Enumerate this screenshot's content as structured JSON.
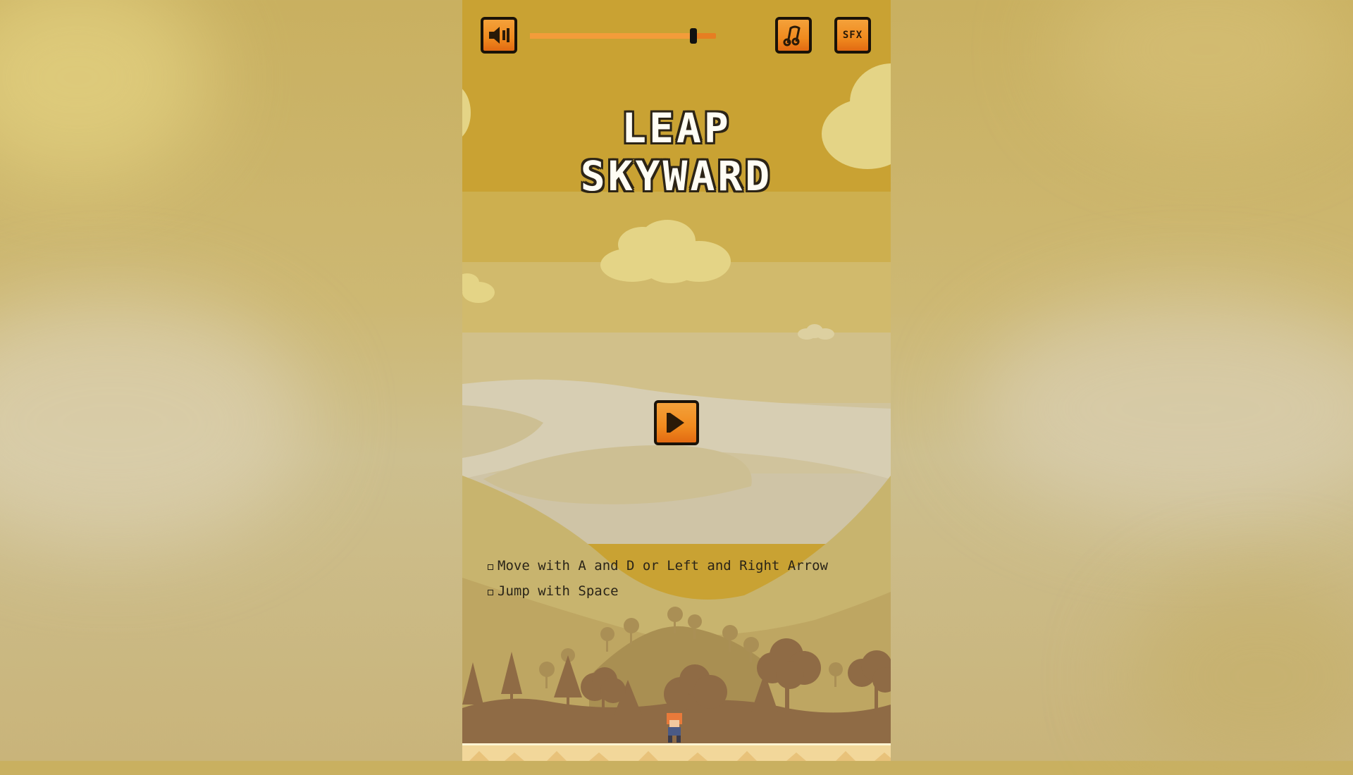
{
  "game": {
    "title_line1": "LEAP",
    "title_line2": "SKYWARD",
    "instructions": [
      "Move with A and D or Left and Right Arrow",
      "Jump with Space"
    ]
  },
  "controls": {
    "volume_level": 0.88,
    "buttons": {
      "sound": "speaker-icon",
      "music": "music-note-icon",
      "sfx": "SFX",
      "play": "play-icon"
    }
  },
  "colors": {
    "button_orange": "#f08a1e",
    "slider_orange": "#e67e22",
    "title_text": "#fffdf4",
    "sky": "#c9a233"
  }
}
